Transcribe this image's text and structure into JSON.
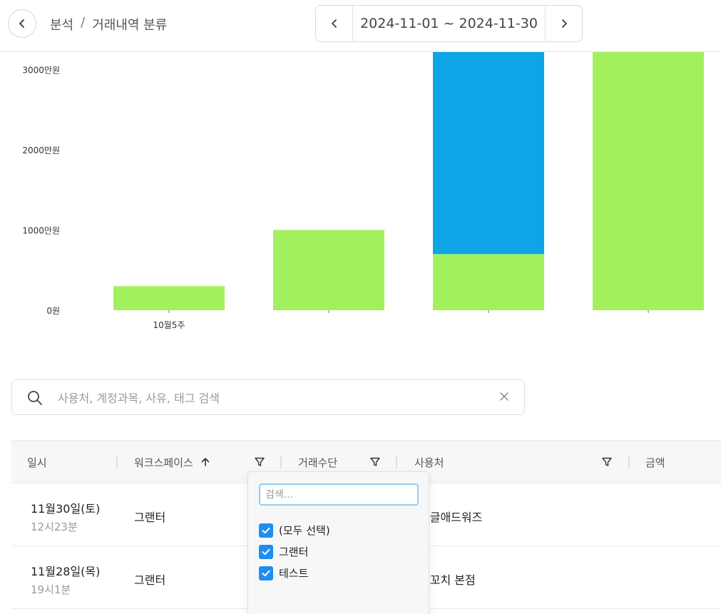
{
  "header": {
    "breadcrumb": [
      "분석",
      "거래내역 분류"
    ],
    "separator": "/",
    "date_range": "2024-11-01 ~ 2024-11-30"
  },
  "colors": {
    "green": "#a3f05e",
    "blue": "#0ea5e6"
  },
  "chart_data": {
    "type": "bar",
    "stacked": true,
    "categories": [
      "10월5주",
      "",
      "",
      ""
    ],
    "series": [
      {
        "color": "#a3f05e",
        "values": [
          300,
          1000,
          700,
          3250
        ]
      },
      {
        "color": "#0ea5e6",
        "values": [
          0,
          0,
          2550,
          0
        ]
      }
    ],
    "y_ticks": [
      {
        "value": 0,
        "label": "0원"
      },
      {
        "value": 1000,
        "label": "1000만원"
      },
      {
        "value": 2000,
        "label": "2000만원"
      },
      {
        "value": 3000,
        "label": "3000만원"
      }
    ],
    "ylim": [
      0,
      3220
    ]
  },
  "search": {
    "placeholder": "사용처, 계정과목, 사유, 태그 검색",
    "value": ""
  },
  "table": {
    "columns": [
      "일시",
      "워크스페이스",
      "거래수단",
      "사용처",
      "금액"
    ],
    "rows": [
      {
        "date": "11월30일(토)",
        "time": "12시23분",
        "workspace": "그랜터",
        "payee": "구글애드워즈"
      },
      {
        "date": "11월28일(목)",
        "time": "19시1분",
        "workspace": "그랜터",
        "payee": "양꼬치 본점"
      }
    ]
  },
  "filter_dropdown": {
    "search_placeholder": "검색...",
    "options": [
      {
        "label": "(모두 선택)",
        "checked": true
      },
      {
        "label": "그랜터",
        "checked": true
      },
      {
        "label": "테스트",
        "checked": true
      }
    ]
  }
}
